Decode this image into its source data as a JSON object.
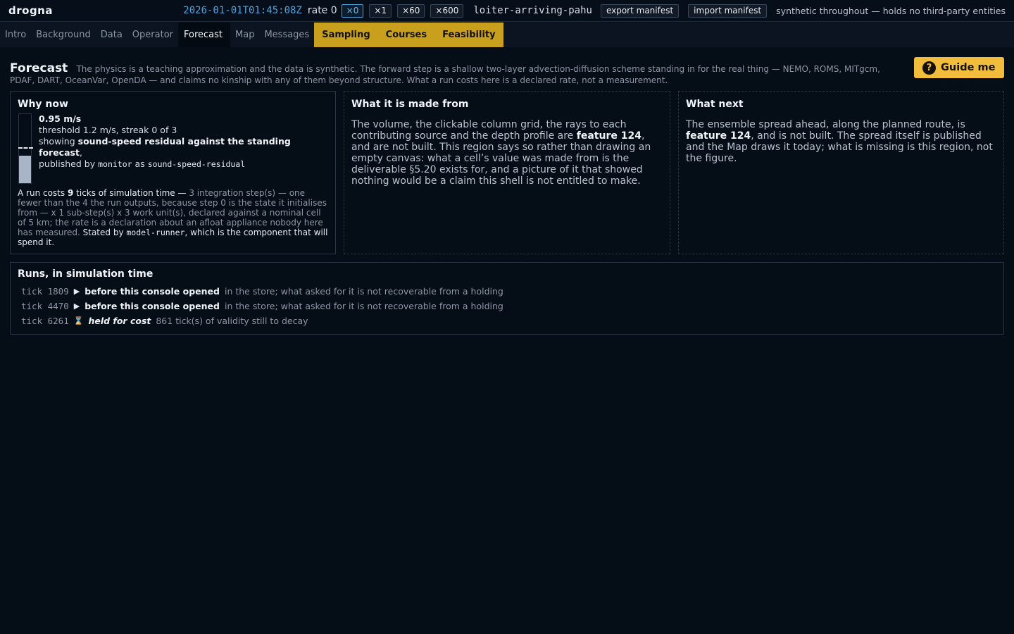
{
  "app": {
    "name": "drogna"
  },
  "topbar": {
    "clock": "2026-01-01T01:45:08Z",
    "rate_label": "rate 0",
    "speeds": [
      "×0",
      "×1",
      "×60",
      "×600"
    ],
    "session": "loiter-arriving-pahu",
    "export_label": "export manifest",
    "import_label": "import manifest",
    "note": "synthetic throughout — holds no third-party entities"
  },
  "tabs": [
    {
      "label": "Intro"
    },
    {
      "label": "Background"
    },
    {
      "label": "Data"
    },
    {
      "label": "Operator"
    },
    {
      "label": "Forecast",
      "active": true
    },
    {
      "label": "Map"
    },
    {
      "label": "Messages"
    },
    {
      "label": "Sampling",
      "highlight": true
    },
    {
      "label": "Courses",
      "highlight": true
    },
    {
      "label": "Feasibility",
      "highlight": true
    }
  ],
  "page": {
    "title": "Forecast",
    "description": "The physics is a teaching approximation and the data is synthetic. The forward step is a shallow two-layer advection-diffusion scheme standing in for the real thing — NEMO, ROMS, MITgcm, PDAF, DART, OceanVar, OpenDA — and claims no kinship with any of them beyond structure. What a run costs here is a declared rate, not a measurement.",
    "guide_label": "Guide me"
  },
  "why_now": {
    "title": "Why now",
    "value_text": "0.95 m/s",
    "value": 0.95,
    "threshold": 1.2,
    "gauge_max": 2.4,
    "threshold_text": "threshold 1.2 m/s, streak 0 of 3",
    "showing_prefix": "showing",
    "showing_metric": "sound-speed residual against the standing forecast",
    "published_by_prefix": "published by",
    "publisher": "monitor",
    "as_word": "as",
    "feed": "sound-speed-residual",
    "cost": {
      "t1": "A run costs",
      "ticks": "9",
      "t2": "ticks of simulation time —",
      "t3": "3 integration step(s) — one fewer than the 4 the run outputs, because step 0 is the state it initialises from — x 1 sub-step(s) x 3 work unit(s), declared against a nominal cell of 5 km; the rate is a declaration about an afloat appliance nobody here has measured.",
      "t4": "Stated by",
      "runner": "model-runner",
      "t5": ", which is the component that will spend it."
    }
  },
  "made_from": {
    "title": "What it is made from",
    "t1": "The volume, the clickable column grid, the rays to each contributing source and the depth profile are",
    "feature": "feature 124",
    "t2": ", and are not built. This region says so rather than drawing an empty canvas: what a cell’s value was made from is the deliverable §5.20 exists for, and a picture of it that showed nothing would be a claim this shell is not entitled to make."
  },
  "what_next": {
    "title": "What next",
    "t1": "The ensemble spread ahead, along the planned route, is",
    "feature": "feature 124",
    "t2": ", and is not built. The spread itself is published and the Map draws it today; what is missing is this region, not the figure."
  },
  "runs": {
    "title": "Runs, in simulation time",
    "items": [
      {
        "tick": "tick 1809",
        "icon": "▶",
        "icon_name": "play-icon",
        "status": "before this console opened",
        "italic": false,
        "desc": "in the store; what asked for it is not recoverable from a holding"
      },
      {
        "tick": "tick 4470",
        "icon": "▶",
        "icon_name": "play-icon",
        "status": "before this console opened",
        "italic": false,
        "desc": "in the store; what asked for it is not recoverable from a holding"
      },
      {
        "tick": "tick 6261",
        "icon": "⌛",
        "icon_name": "hourglass-icon",
        "status": "held for cost",
        "italic": true,
        "desc": "861 tick(s) of validity still to decay"
      }
    ]
  }
}
